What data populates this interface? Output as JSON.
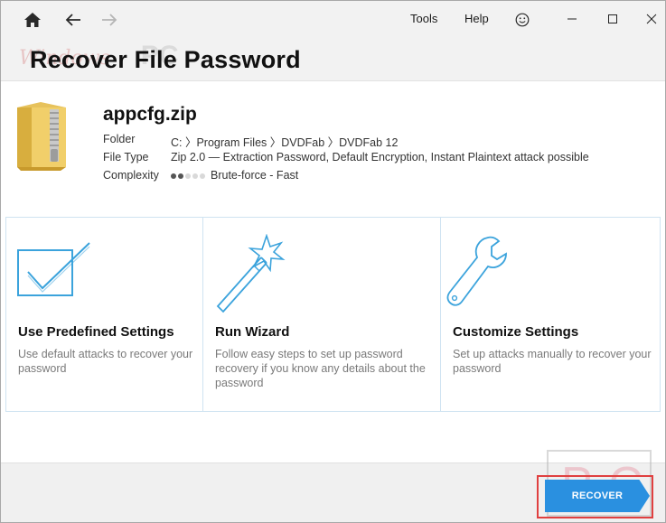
{
  "toolbar": {
    "menu": {
      "tools": "Tools",
      "help": "Help"
    }
  },
  "header": {
    "title": "Recover File Password",
    "watermark_script": "Windows",
    "watermark_bold": "PC"
  },
  "file": {
    "name": "appcfg.zip",
    "folder_label": "Folder",
    "folder_value": "C: 〉Program Files 〉DVDFab 〉DVDFab 12",
    "type_label": "File Type",
    "type_value": "Zip 2.0 — Extraction Password, Default Encryption, Instant Plaintext attack possible",
    "complexity_label": "Complexity",
    "complexity_value": "Brute-force - Fast",
    "complexity_level": 2,
    "complexity_max": 5
  },
  "options": [
    {
      "title": "Use Predefined Settings",
      "desc": "Use default attacks to recover your password",
      "icon": "checkbox-icon"
    },
    {
      "title": "Run Wizard",
      "desc": "Follow easy steps to set up password recovery if you know any details about the password",
      "icon": "magic-wand-icon"
    },
    {
      "title": "Customize Settings",
      "desc": "Set up attacks manually to recover your password",
      "icon": "wrench-icon"
    }
  ],
  "footer": {
    "recover_label": "RECOVER",
    "watermark": "PC"
  },
  "colors": {
    "accent": "#2a90e0",
    "icon_blue": "#3ba3dc",
    "highlight": "#e04040"
  }
}
